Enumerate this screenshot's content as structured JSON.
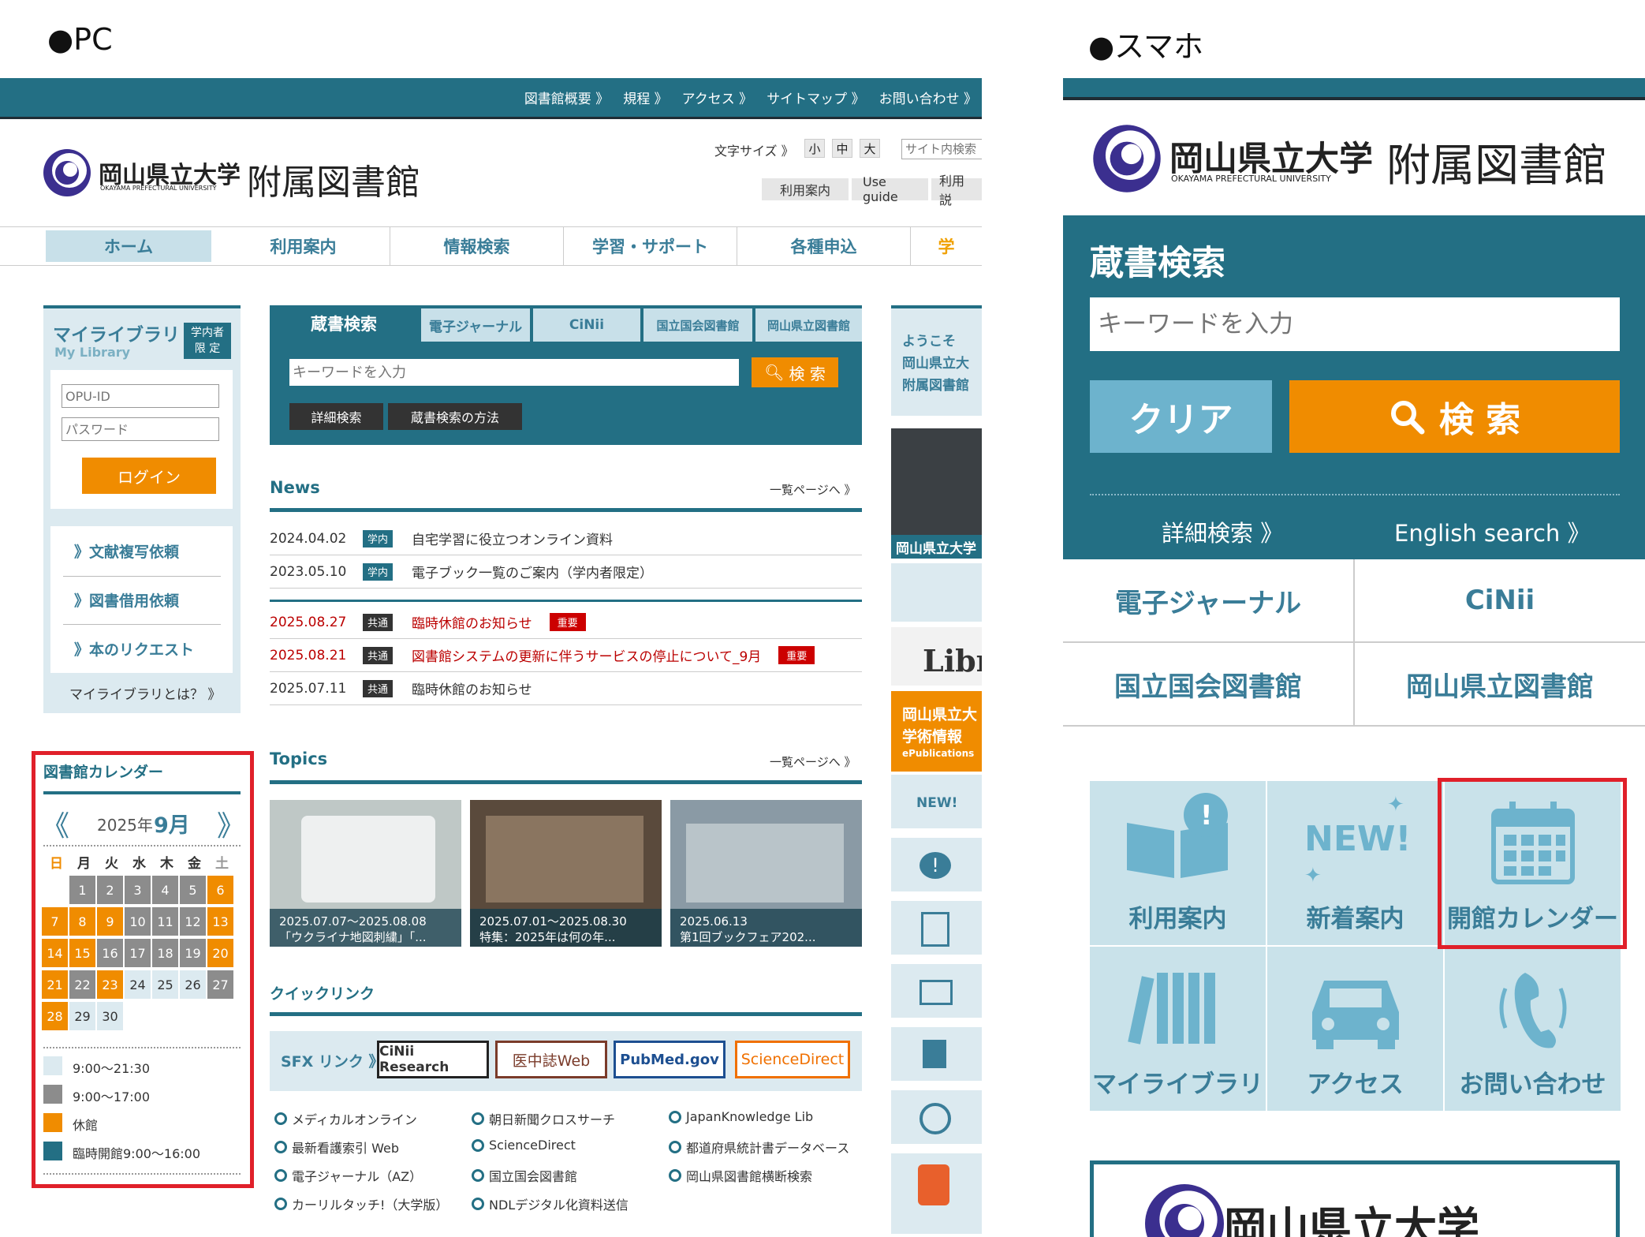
{
  "section_labels": {
    "pc": "●PC",
    "smartphone": "●スマホ"
  },
  "pc": {
    "top_links": [
      "図書館概要 》",
      "規程 》",
      "アクセス 》",
      "サイトマップ 》",
      "お問い合わせ 》"
    ],
    "logo": {
      "univ_jp": "岡山県立大学",
      "univ_en": "OKAYAMA PREFECTURAL UNIVERSITY",
      "library": "附属図書館"
    },
    "font_size": {
      "label": "文字サイズ 》",
      "small": "小",
      "medium": "中",
      "large": "大"
    },
    "site_search_placeholder": "サイト内検索",
    "header_buttons": [
      "利用案内",
      "Use guide",
      "利用説"
    ],
    "main_nav": [
      "ホーム",
      "利用案内",
      "情報検索",
      "学習・サポート",
      "各種申込",
      "学"
    ],
    "mylibrary": {
      "title": "マイライブラリ",
      "subtitle": "My Library",
      "badge": "学内者 限 定",
      "id_placeholder": "OPU-ID",
      "pw_placeholder": "パスワード",
      "login": "ログイン",
      "links": [
        "》文献複写依頼",
        "》図書借用依頼",
        "》本のリクエスト"
      ],
      "about": "マイライブラリとは？ 》"
    },
    "calendar": {
      "title": "図書館カレンダー",
      "prev": "《",
      "next": "》",
      "year": "2025年",
      "month": "9月",
      "weekdays": [
        "日",
        "月",
        "火",
        "水",
        "木",
        "金",
        "土"
      ],
      "days": [
        [
          "",
          "1",
          "2",
          "3",
          "4",
          "5",
          "6"
        ],
        [
          "7",
          "8",
          "9",
          "10",
          "11",
          "12",
          "13"
        ],
        [
          "14",
          "15",
          "16",
          "17",
          "18",
          "19",
          "20"
        ],
        [
          "21",
          "22",
          "23",
          "24",
          "25",
          "26",
          "27"
        ],
        [
          "28",
          "29",
          "30",
          "",
          "",
          "",
          ""
        ]
      ],
      "legend": [
        "9:00～21:30",
        "9:00～17:00",
        "休館",
        "臨時開館9:00～16:00"
      ]
    },
    "search": {
      "tabs": [
        "蔵書検索",
        "電子ジャーナル",
        "CiNii",
        "国立国会図書館",
        "岡山県立図書館"
      ],
      "placeholder": "キーワードを入力",
      "button": "検 索",
      "sub_buttons": [
        "詳細検索",
        "蔵書検索の方法"
      ]
    },
    "news": {
      "title": "News",
      "more": "一覧ページへ 》",
      "items": [
        {
          "date": "2024.04.02",
          "tag": "学内",
          "text": "自宅学習に役立つオンライン資料",
          "important": ""
        },
        {
          "date": "2023.05.10",
          "tag": "学内",
          "text": "電子ブック一覧のご案内（学内者限定）",
          "important": ""
        },
        {
          "date": "2025.08.27",
          "tag": "共通",
          "text": "臨時休館のお知らせ",
          "important": "重要"
        },
        {
          "date": "2025.08.21",
          "tag": "共通",
          "text": "図書館システムの更新に伴うサービスの停止について_9月",
          "important": "重要"
        },
        {
          "date": "2025.07.11",
          "tag": "共通",
          "text": "臨時休館のお知らせ",
          "important": ""
        }
      ]
    },
    "topics": {
      "title": "Topics",
      "more": "一覧ページへ 》",
      "items": [
        {
          "line1": "2025.07.07～2025.08.08",
          "line2": "「ウクライナ地図刺繍」「..."
        },
        {
          "line1": "2025.07.01～2025.08.30",
          "line2": "特集：2025年は何の年..."
        },
        {
          "line1": "2025.06.13",
          "line2": "第1回ブックフェア202..."
        }
      ]
    },
    "quicklinks": {
      "title": "クイックリンク",
      "sfx": "SFX リンク 》",
      "logos": [
        "CiNii Research",
        "医中誌Web",
        "PubMed.gov",
        "ScienceDirect"
      ],
      "links": [
        "メディカルオンライン",
        "朝日新聞クロスサーチ",
        "JapanKnowledge Lib",
        "最新看護索引 Web",
        "ScienceDirect",
        "都道府県統計書データベース",
        "電子ジャーナル（AZ）",
        "国立国会図書館",
        "岡山県図書館横断検索",
        "カーリルタッチ!（大学版）",
        "NDLデジタル化資料送信"
      ]
    },
    "side": {
      "welcome": [
        "ようこそ",
        "岡山県立大",
        "附属図書館"
      ],
      "photo_caption": "岡山県立大学",
      "new_label": "NEW!",
      "libr": "Libr",
      "epub": [
        "岡山県立大",
        "学術情報",
        "ePublications"
      ]
    }
  },
  "mobile": {
    "logo": {
      "univ_jp": "岡山県立大学",
      "univ_en": "OKAYAMA PREFECTURAL UNIVERSITY",
      "library": "附属図書館"
    },
    "search": {
      "title": "蔵書検索",
      "placeholder": "キーワードを入力",
      "clear": "クリア",
      "button": "検 索",
      "advanced": "詳細検索 》",
      "english": "English search 》"
    },
    "db_links": [
      "電子ジャーナル",
      "CiNii",
      "国立国会図書館",
      "岡山県立図書館"
    ],
    "tiles": [
      "利用案内",
      "新着案内",
      "開館カレンダー",
      "マイライブラリ",
      "アクセス",
      "お問い合わせ"
    ],
    "bottom_logo": "岡山県立大学"
  },
  "colors": {
    "teal": "#236f84",
    "orange": "#f08c00",
    "light": "#dceaf0",
    "highlight": "#e0202a"
  }
}
